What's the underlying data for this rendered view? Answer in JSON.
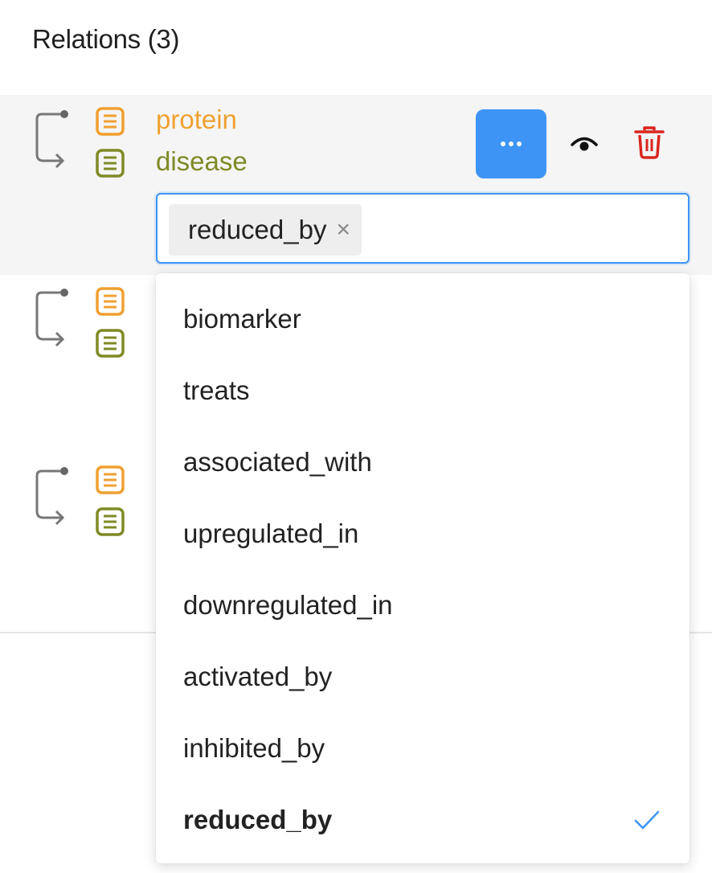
{
  "panel": {
    "title": "Relations (3)"
  },
  "relations": [
    {
      "from_label": "protein",
      "to_label": "disease",
      "actions": {
        "more_icon": "ellipsis-icon",
        "view_icon": "eye-icon",
        "delete_icon": "trash-icon"
      },
      "selected_tag": "reduced_by",
      "tag_remove": "×"
    },
    {},
    {}
  ],
  "dropdown": {
    "options": [
      "biomarker",
      "treats",
      "associated_with",
      "upregulated_in",
      "downregulated_in",
      "activated_by",
      "inhibited_by",
      "reduced_by"
    ],
    "selected": "reduced_by"
  },
  "colors": {
    "from_entity": "#f0a030",
    "to_entity": "#7f8a25",
    "primary": "#3d94f5",
    "delete": "#d9251d"
  }
}
